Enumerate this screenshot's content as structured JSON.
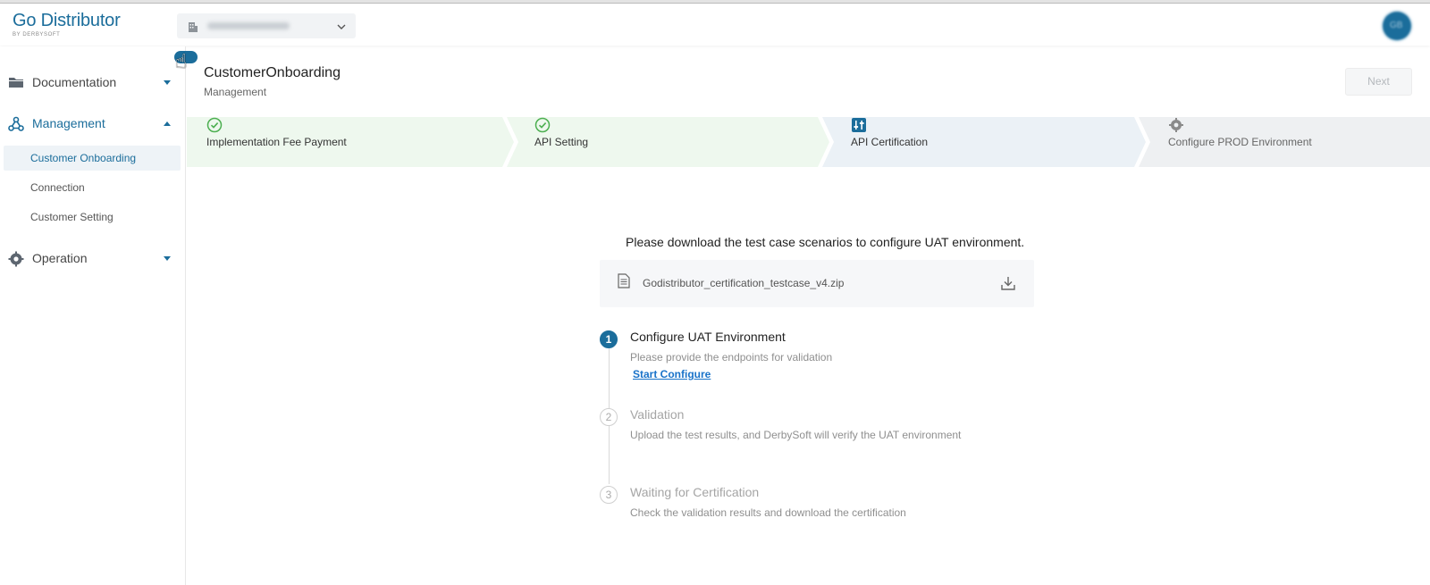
{
  "app": {
    "logo_title": "Go Distributor",
    "logo_subtitle": "BY DERBYSOFT",
    "brand_color": "#1b6d9b",
    "company_selector_icon": "building-icon",
    "company_selector_chevron": "chevron-down-icon"
  },
  "sidebar": {
    "groups": [
      {
        "label": "Documentation",
        "icon": "folder-icon",
        "expanded": false
      },
      {
        "label": "Management",
        "icon": "network-icon",
        "expanded": true,
        "items": [
          {
            "label": "Customer Onboarding",
            "selected": true
          },
          {
            "label": "Connection",
            "selected": false
          },
          {
            "label": "Customer Setting",
            "selected": false
          }
        ]
      },
      {
        "label": "Operation",
        "icon": "gear-icon",
        "expanded": false
      }
    ]
  },
  "header": {
    "title": "CustomerOnboarding",
    "breadcrumb": "Management",
    "next_label": "Next"
  },
  "stepper": {
    "steps": [
      {
        "label": "Implementation Fee Payment",
        "status": "done",
        "icon": "check-circle-icon",
        "color": "#4caf50"
      },
      {
        "label": "API Setting",
        "status": "done",
        "icon": "check-circle-icon",
        "color": "#4caf50"
      },
      {
        "label": "API Certification",
        "status": "current",
        "icon": "sliders-icon",
        "color": "#1b6d9b"
      },
      {
        "label": "Configure PROD Environment",
        "status": "pending",
        "icon": "gear-icon",
        "color": "#8a8a8a"
      }
    ]
  },
  "main": {
    "instruction": "Please download the test case scenarios to configure UAT environment.",
    "file": {
      "name": "Godistributor_certification_testcase_v4.zip",
      "icon": "document-icon",
      "download_icon": "download-icon"
    },
    "steps": [
      {
        "number": "1",
        "title": "Configure UAT Environment",
        "description": "Please provide the endpoints for validation",
        "link": "Start Configure",
        "active": true
      },
      {
        "number": "2",
        "title": "Validation",
        "description": "Upload the test results, and DerbySoft will verify the UAT environment",
        "active": false
      },
      {
        "number": "3",
        "title": "Waiting for Certification",
        "description": "Check the validation results and download the certification",
        "active": false
      }
    ]
  }
}
